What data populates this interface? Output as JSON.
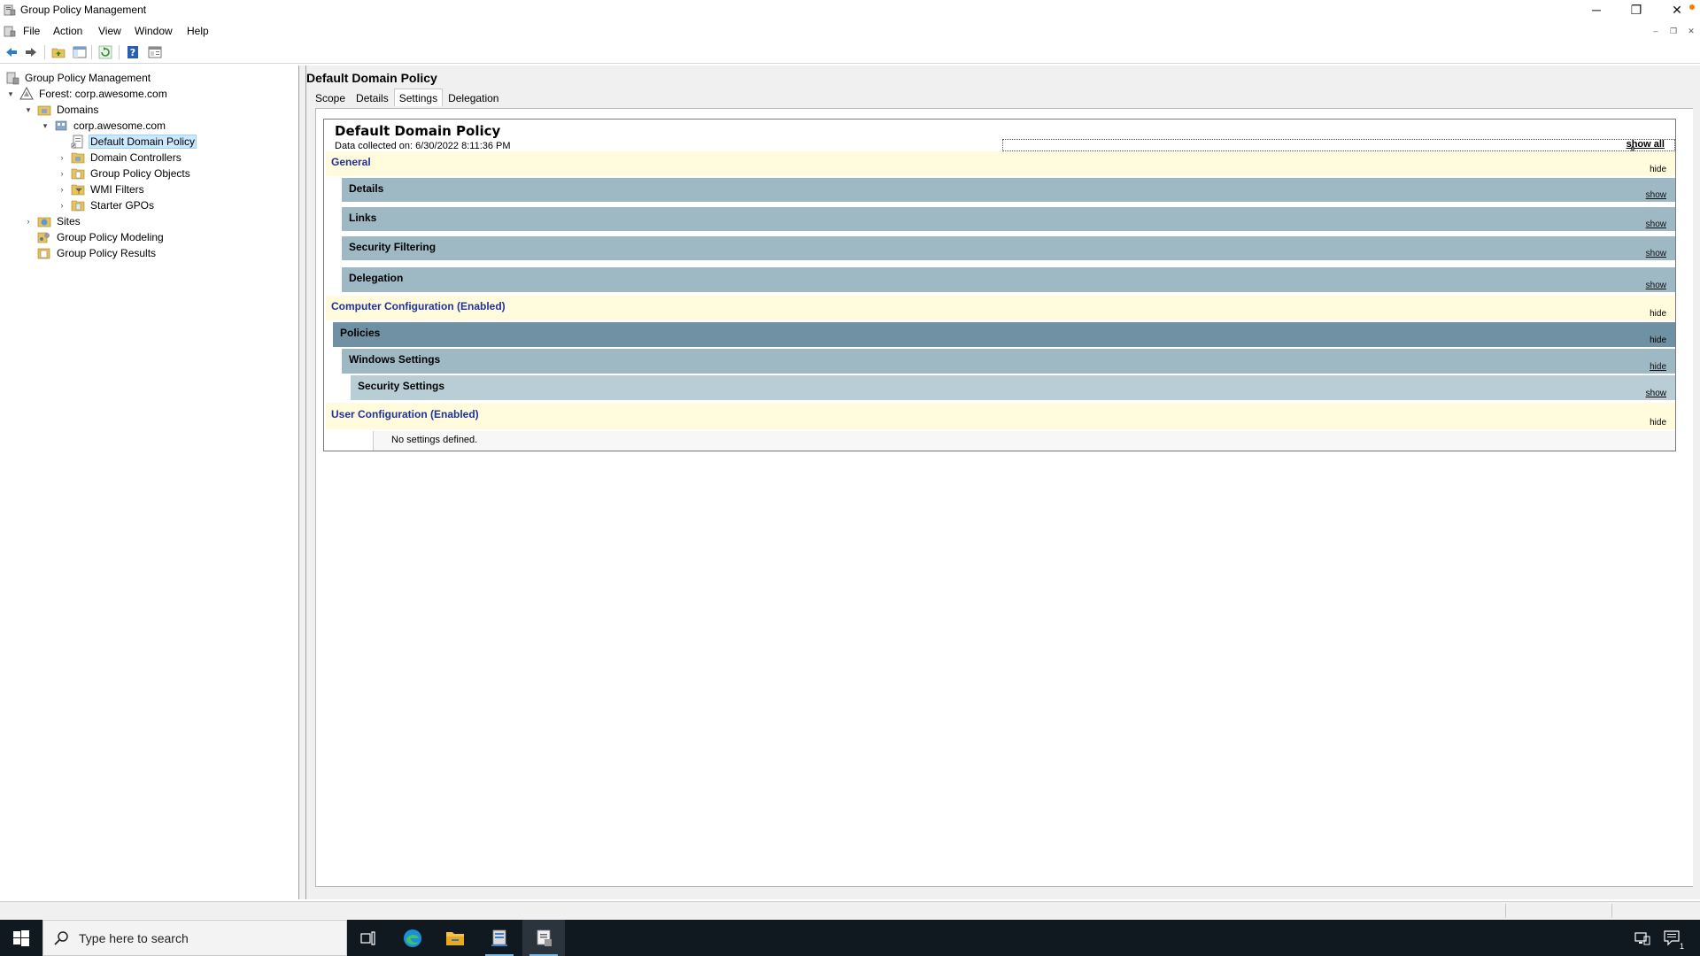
{
  "window": {
    "title": "Group Policy Management",
    "minimize_glyph": "─",
    "restore_glyph": "❐",
    "close_glyph": "✕"
  },
  "menu": {
    "items": [
      "File",
      "Action",
      "View",
      "Window",
      "Help"
    ],
    "mdi_minimize": "–",
    "mdi_restore": "❐",
    "mdi_close": "✕"
  },
  "toolbar": {
    "buttons": [
      "back-icon",
      "forward-icon",
      "up-folder-icon",
      "show-hide-console-tree-icon",
      "refresh-icon",
      "help-icon",
      "properties-icon"
    ]
  },
  "tree": {
    "root": "Group Policy Management",
    "forest": "Forest: corp.awesome.com",
    "domains": "Domains",
    "domain": "corp.awesome.com",
    "default_domain_policy": "Default Domain Policy",
    "domain_controllers": "Domain Controllers",
    "gpo": "Group Policy Objects",
    "wmi_filters": "WMI Filters",
    "starter_gpos": "Starter GPOs",
    "sites": "Sites",
    "modeling": "Group Policy Modeling",
    "results": "Group Policy Results"
  },
  "main": {
    "title": "Default Domain Policy",
    "tabs": [
      "Scope",
      "Details",
      "Settings",
      "Delegation"
    ],
    "active_tab": "Settings"
  },
  "report": {
    "title": "Default Domain Policy",
    "date_text": "Data collected on: 6/30/2022 8:11:36 PM",
    "show_all": "show all",
    "sections": {
      "general": {
        "label": "General",
        "toggle": "hide"
      },
      "details": {
        "label": "Details",
        "toggle": "show"
      },
      "links": {
        "label": "Links",
        "toggle": "show"
      },
      "security_filtering": {
        "label": "Security Filtering",
        "toggle": "show"
      },
      "delegation": {
        "label": "Delegation",
        "toggle": "show"
      },
      "computer_config": {
        "label": "Computer Configuration (Enabled)",
        "toggle": "hide"
      },
      "policies": {
        "label": "Policies",
        "toggle": "hide"
      },
      "windows_settings": {
        "label": "Windows Settings",
        "toggle": "hide"
      },
      "security_settings": {
        "label": "Security Settings",
        "toggle": "show"
      },
      "user_config": {
        "label": "User Configuration (Enabled)",
        "toggle": "hide"
      }
    },
    "no_settings": "No settings defined."
  },
  "taskbar": {
    "search_placeholder": "Type here to search",
    "apps": [
      "task-view-icon",
      "edge-icon",
      "file-explorer-icon",
      "server-manager-icon",
      "group-policy-icon"
    ],
    "notification_count": "1"
  },
  "colors": {
    "general_bg": "#fffbdc",
    "section_blue": "#9eb8c4",
    "section_dark": "#6f91a3",
    "section_light": "#b8cdd6",
    "link_blue": "#20339a",
    "taskbar": "#101820"
  }
}
